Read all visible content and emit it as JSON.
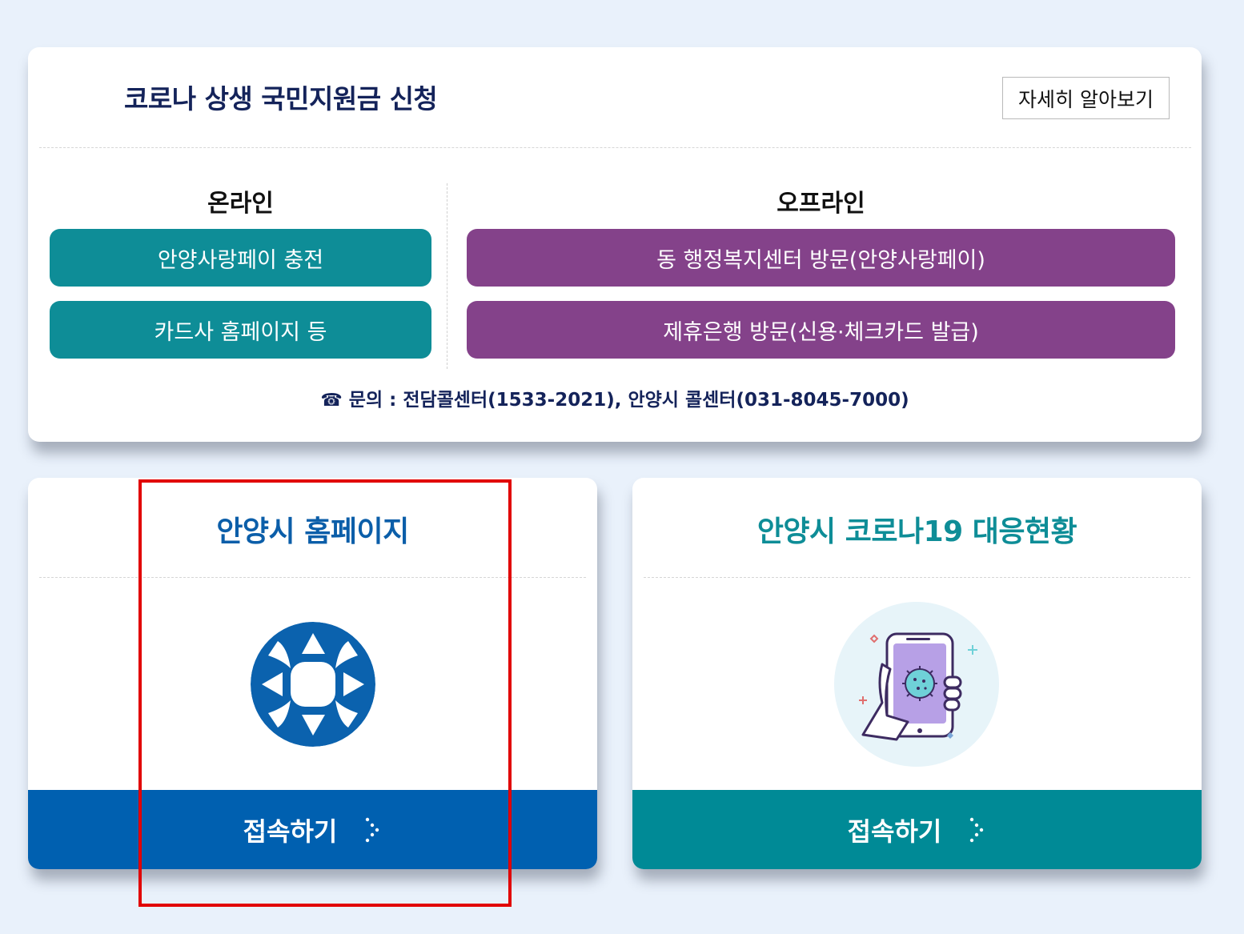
{
  "top_card": {
    "title": "코로나 상생 국민지원금 신청",
    "more_button": "자세히 알아보기",
    "online": {
      "heading": "온라인",
      "buttons": [
        "안양사랑페이 충전",
        "카드사 홈페이지 등"
      ]
    },
    "offline": {
      "heading": "오프라인",
      "buttons": [
        "동 행정복지센터 방문(안양사랑페이)",
        "제휴은행 방문(신용·체크카드 발급)"
      ]
    },
    "contact_icon": "☎",
    "contact_text": "문의 : 전담콜센터(1533-2021), 안양시 콜센터(031-8045-7000)"
  },
  "cards": [
    {
      "title": "안양시 홈페이지",
      "icon": "globe-icon",
      "button": "접속하기",
      "color": "#0060b0"
    },
    {
      "title": "안양시 코로나19 대응현황",
      "icon": "phone-virus-icon",
      "button": "접속하기",
      "color": "#008a96"
    }
  ],
  "colors": {
    "teal": "#0e8d97",
    "purple": "#84428a",
    "navy": "#14235a",
    "blue": "#0060b0",
    "highlight": "#e10000"
  }
}
